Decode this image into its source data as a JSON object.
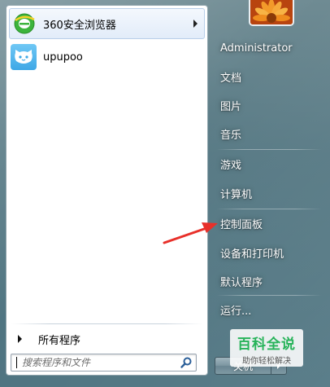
{
  "left_pane": {
    "pinned": [
      {
        "label": "360安全浏览器",
        "icon": "360-browser-icon",
        "has_submenu": true
      },
      {
        "label": "upupoo",
        "icon": "upupoo-icon",
        "has_submenu": false
      }
    ],
    "all_programs_label": "所有程序",
    "search": {
      "placeholder": "搜索程序和文件",
      "value": ""
    }
  },
  "right_pane": {
    "user_picture": "user-flower-picture",
    "items": [
      {
        "label": "Administrator"
      },
      {
        "label": "文档"
      },
      {
        "label": "图片"
      },
      {
        "label": "音乐"
      },
      {
        "label": "游戏"
      },
      {
        "label": "计算机"
      },
      {
        "label": "控制面板"
      },
      {
        "label": "设备和打印机"
      },
      {
        "label": "默认程序"
      },
      {
        "label": "运行..."
      }
    ],
    "shutdown_label": "关机"
  },
  "watermark": {
    "title": "百科全说",
    "subtitle": "助你轻松解决"
  },
  "annotation": {
    "color": "#e8302a",
    "target": "控制面板"
  },
  "colors": {
    "frame": "#587a85",
    "left_pane_bg": "#ffffff",
    "highlight": "#e2ecf9",
    "watermark_green": "#27b35a"
  }
}
